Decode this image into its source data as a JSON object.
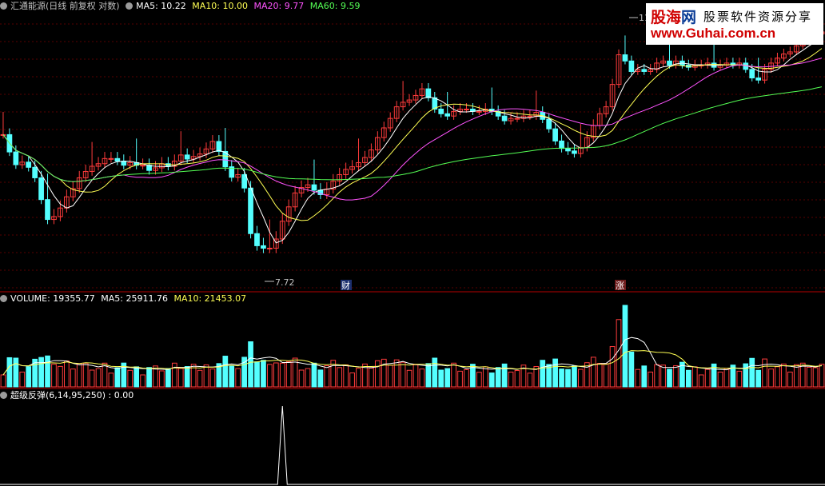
{
  "colors": {
    "up": "#ff3c3c",
    "down": "#54ffff",
    "ma5": "#ffffff",
    "ma10": "#ffff54",
    "ma20": "#ff54ff",
    "ma60": "#54ff54",
    "grid": "#5a0000",
    "divider": "#b40000"
  },
  "header_price": {
    "title": "汇通能源(日线 前复权 对数)",
    "ma5_label": "MA5: 10.22",
    "ma10_label": "MA10: 10.00",
    "ma20_label": "MA20: 9.77",
    "ma60_label": "MA60: 9.59"
  },
  "header_volume": {
    "title": "VOLUME: 19355.77",
    "ma5_label": "MA5: 25911.76",
    "ma10_label": "MA10: 21453.07"
  },
  "header_indicator": {
    "title": "超级反弹(6,14,95,250) : 0.00"
  },
  "annotations": {
    "low_label": "7.72",
    "high_label": "11",
    "finance_marker": "财",
    "rise_marker": "涨"
  },
  "watermark": {
    "logo_a": "股海",
    "logo_b": "网",
    "slogan": "股票软件资源分享",
    "url": "www.Guhai.com.cn"
  },
  "chart_data": {
    "type": "candlestick",
    "price_scale": "log",
    "start_price": 9.8,
    "drift": [
      0,
      -0.35,
      -0.25,
      0.05,
      -0.1,
      -0.2,
      -0.4,
      -0.35,
      0.05,
      0.15,
      0.2,
      0.15,
      0.2,
      0.12,
      0.1,
      0.05,
      0.1,
      0,
      -0.05,
      -0.08,
      0.05,
      -0.05,
      0,
      -0.1,
      0.05,
      0.08,
      -0.05,
      0.1,
      0.12,
      -0.08,
      0.05,
      0.05,
      0.1,
      0.15,
      -0.2,
      -0.3,
      -0.2,
      0.05,
      -0.25,
      -0.8,
      -0.2,
      -0.15,
      -0.2,
      0.15,
      0.3,
      0.25,
      0.25,
      0.1,
      0.05,
      -0.1,
      -0.08,
      0.1,
      0.15,
      0.12,
      0.1,
      0.05,
      0.08,
      0.1,
      0.15,
      0.25,
      0.2,
      0.2,
      0.25,
      0.1,
      0.05,
      0.1,
      0.15,
      -0.2,
      -0.25,
      -0.1,
      -0.05,
      0.1,
      0.05,
      0,
      -0.05,
      0,
      0.05,
      -0.05,
      -0.1,
      -0.1,
      0.05,
      0,
      0.05,
      0,
      0.08,
      -0.15,
      -0.2,
      -0.25,
      -0.15,
      -0.05,
      -0.05,
      0.12,
      0.2,
      0.25,
      0.25,
      0.15,
      0.5,
      0.7,
      -0.15,
      -0.25,
      0.05,
      -0.05,
      0.05,
      0.15,
      0.05,
      -0.1,
      0.1,
      -0.1,
      -0.05,
      0.05,
      0,
      0.05,
      -0.1,
      0.05,
      0.05,
      -0.05,
      0.05,
      -0.15,
      -0.2,
      -0.05,
      0.25,
      0.15,
      0.12,
      0.1,
      0.05,
      0.15,
      0.1,
      0.15,
      0.05,
      0.05
    ],
    "low": 7.72,
    "high_mark": 11,
    "volume_start": 14000,
    "volume_spike_index": 98,
    "indicator_spike_index": 44
  }
}
